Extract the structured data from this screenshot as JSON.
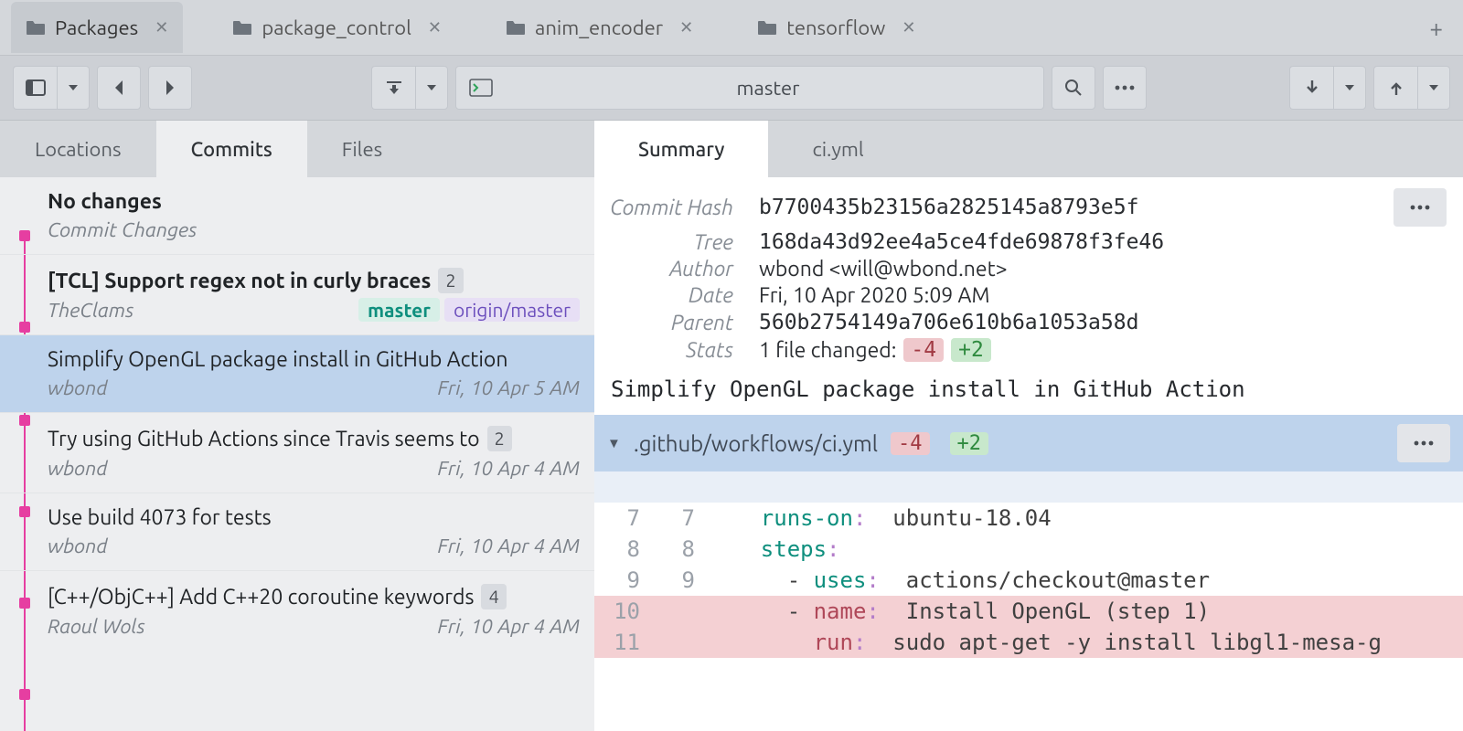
{
  "tabs": [
    "Packages",
    "package_control",
    "anim_encoder",
    "tensorflow"
  ],
  "active_tab": 0,
  "toolbar": {
    "branch": "master"
  },
  "left_subtabs": [
    "Locations",
    "Commits",
    "Files"
  ],
  "left_active_subtab": 1,
  "right_tabs": [
    "Summary",
    "ci.yml"
  ],
  "right_active_tab": 0,
  "commits": [
    {
      "title": "No changes",
      "subtitle": "Commit Changes",
      "bold": true
    },
    {
      "title": "[TCL] Support regex not in curly braces",
      "author": "TheClams",
      "count": "2",
      "bold": true,
      "tags": [
        "master",
        "origin/master"
      ]
    },
    {
      "title": "Simplify OpenGL package install in GitHub Action",
      "author": "wbond",
      "date": "Fri, 10 Apr 5 AM",
      "selected": true
    },
    {
      "title": "Try using GitHub Actions since Travis seems to",
      "author": "wbond",
      "date": "Fri, 10 Apr 4 AM",
      "count": "2"
    },
    {
      "title": "Use build 4073 for tests",
      "author": "wbond",
      "date": "Fri, 10 Apr 4 AM"
    },
    {
      "title": "[C++/ObjC++] Add C++20 coroutine keywords",
      "author": "Raoul Wols",
      "date": "Fri, 10 Apr 4 AM",
      "count": "4"
    }
  ],
  "summary": {
    "hash_label": "Commit Hash",
    "hash": "b7700435b23156a2825145a8793e5f",
    "tree_label": "Tree",
    "tree": "168da43d92ee4a5ce4fde69878f3fe46",
    "author_label": "Author",
    "author": "wbond <will@wbond.net>",
    "date_label": "Date",
    "date": "Fri, 10 Apr 2020 5:09 AM",
    "parent_label": "Parent",
    "parent": "560b2754149a706e610b6a1053a58d",
    "stats_label": "Stats",
    "stats_text": "1 file changed:",
    "stats_neg": "-4",
    "stats_pos": "+2",
    "message": "Simplify OpenGL package install in GitHub Action"
  },
  "file": {
    "path": ".github/workflows/ci.yml",
    "neg": "-4",
    "pos": "+2"
  },
  "diff": [
    {
      "l": "7",
      "r": "7",
      "kind": "ctx",
      "pre": "    ",
      "kw": "runs-on",
      "val": "  ubuntu-18.04"
    },
    {
      "l": "8",
      "r": "8",
      "kind": "ctx",
      "pre": "    ",
      "kw": "steps",
      "val": ""
    },
    {
      "l": "9",
      "r": "9",
      "kind": "ctx",
      "pre": "      - ",
      "kw": "uses",
      "val": "  actions/checkout@master"
    },
    {
      "l": "10",
      "r": "",
      "kind": "del",
      "pre": "      - ",
      "kw": "name",
      "val": "  Install OpenGL (step 1)"
    },
    {
      "l": "11",
      "r": "",
      "kind": "del",
      "pre": "        ",
      "kw": "run",
      "val": "  sudo apt-get -y install libgl1-mesa-g"
    }
  ]
}
